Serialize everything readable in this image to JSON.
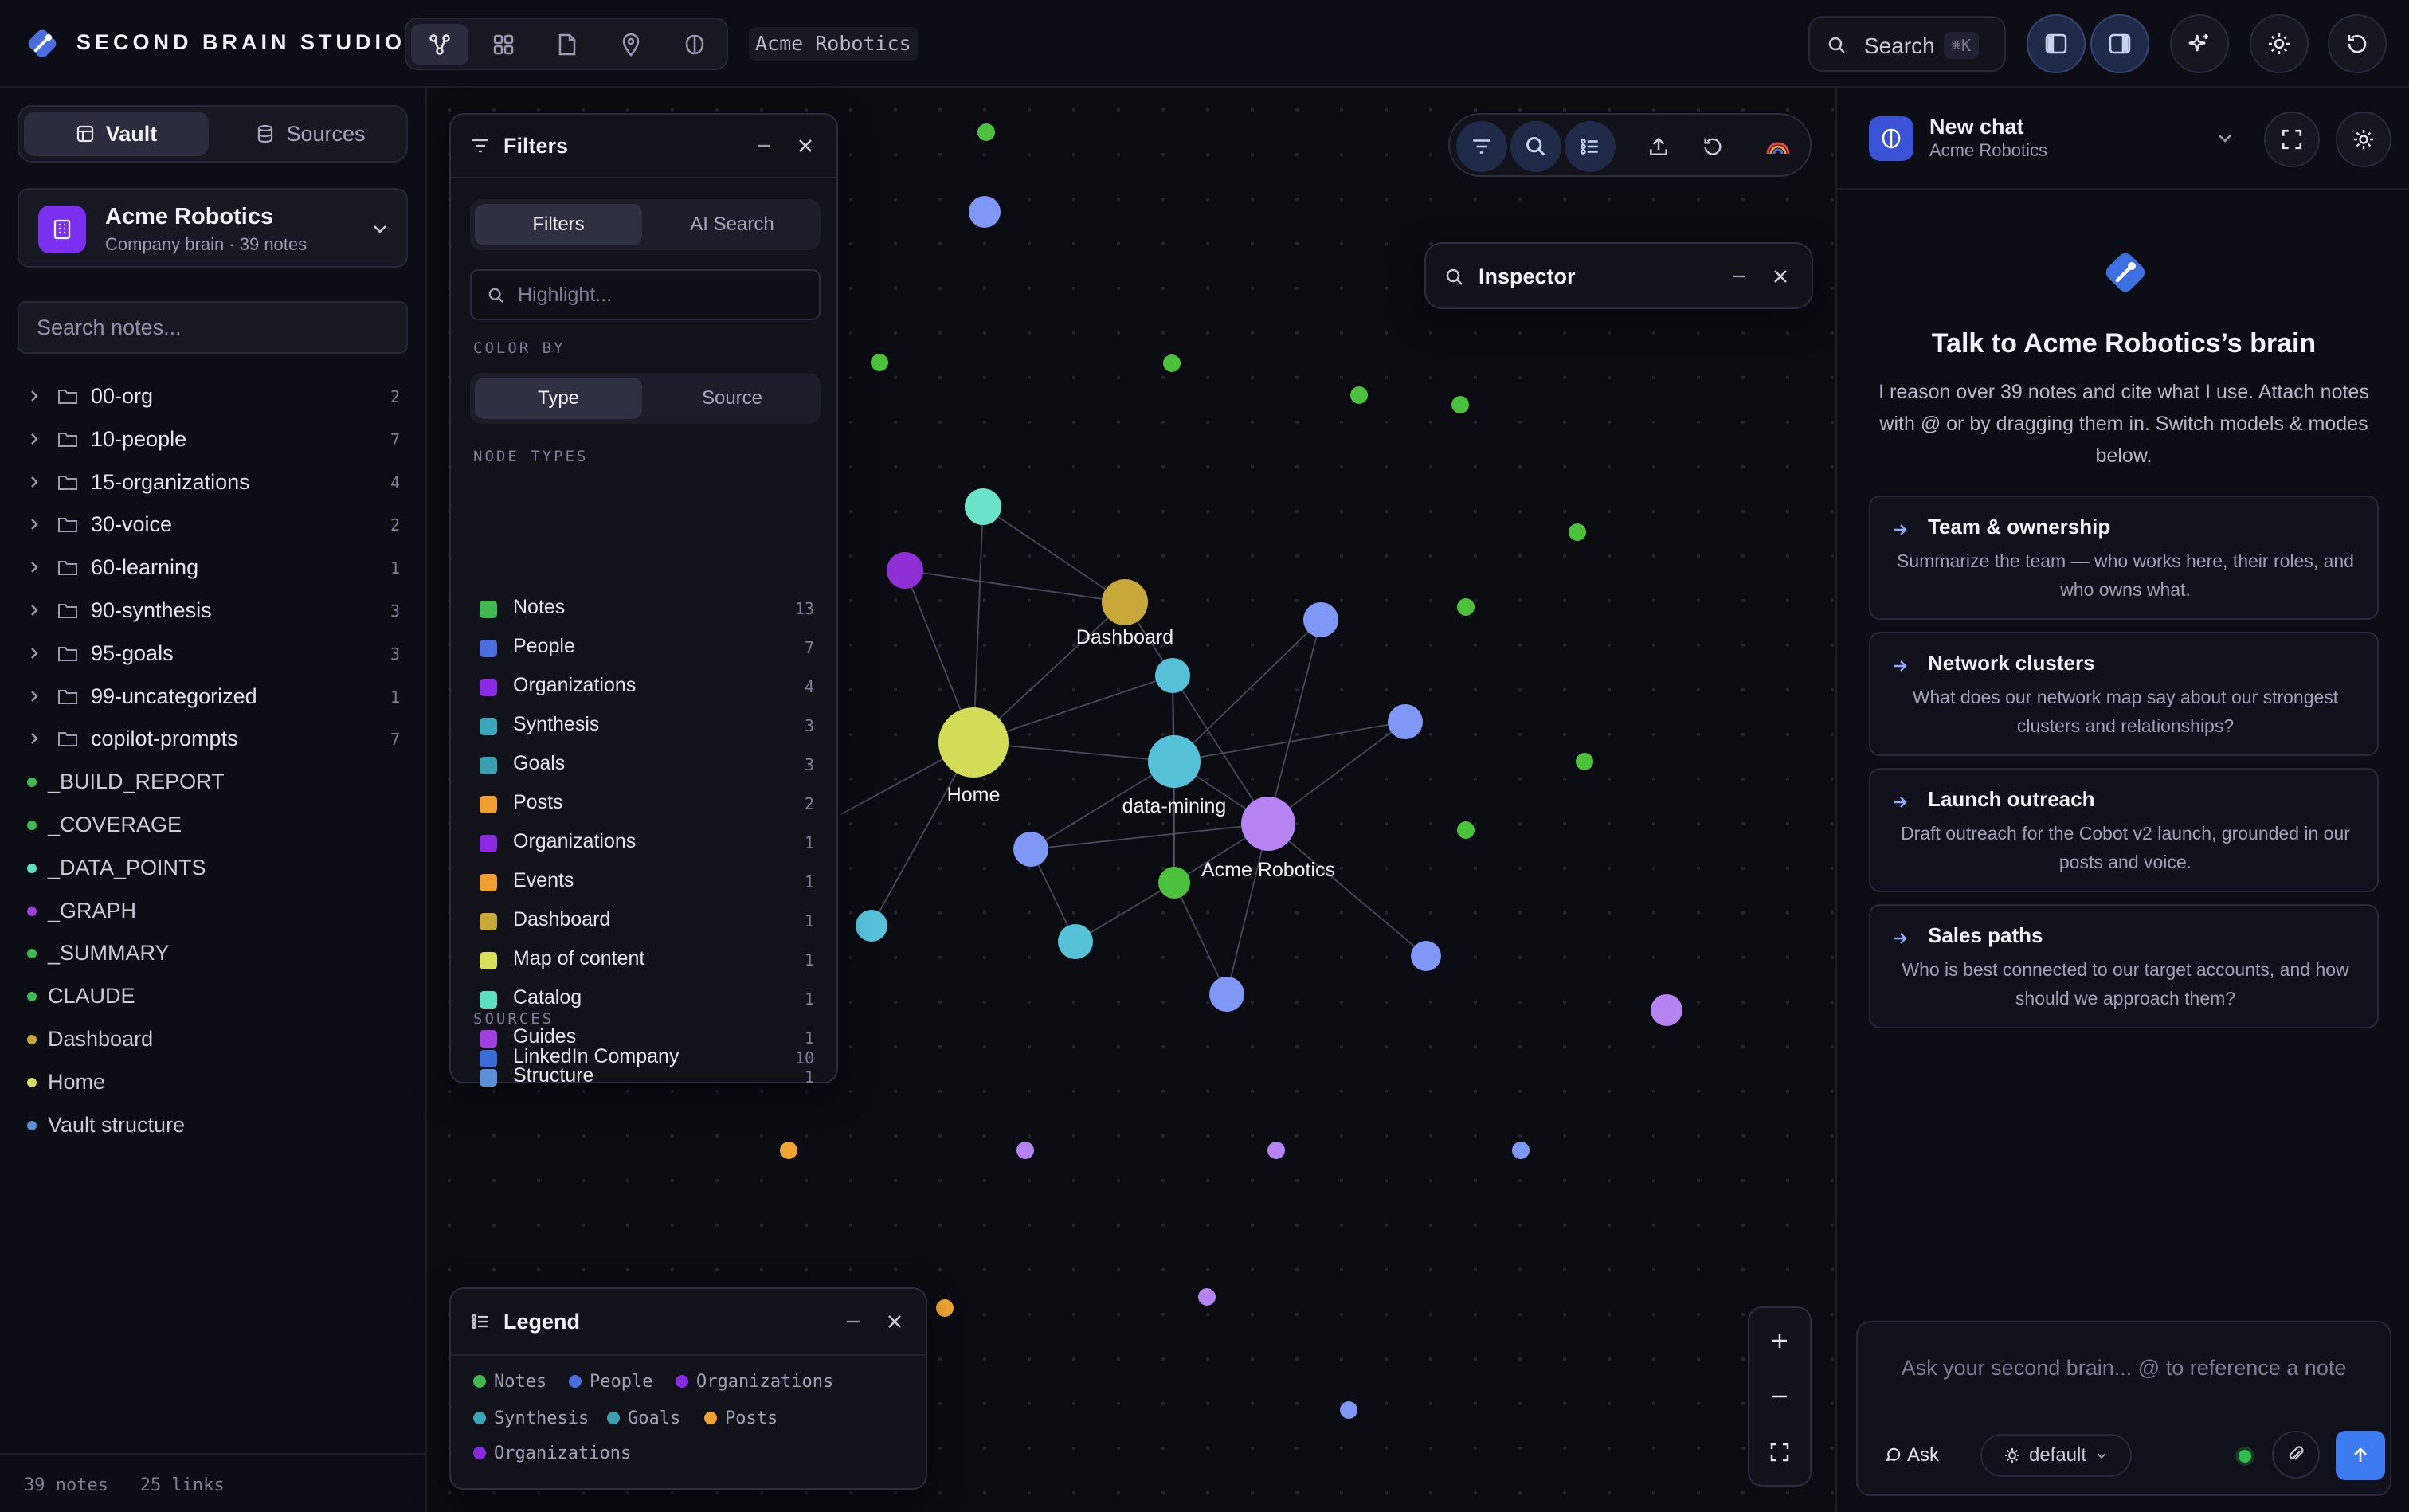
{
  "app": {
    "brand": "SECOND BRAIN STUDIO",
    "workspace_chip": "Acme Robotics",
    "search_label": "Search",
    "search_kbd": "⌘K",
    "mode_icons": [
      "graph-icon",
      "grid-icon",
      "page-icon",
      "pin-icon",
      "brain-icon"
    ],
    "top_icons": [
      "left-panel-icon",
      "right-panel-icon",
      "sparkle-icon",
      "sun-icon",
      "refresh-icon"
    ]
  },
  "sidebar": {
    "tabs": [
      "Vault",
      "Sources"
    ],
    "active_tab": "Vault",
    "vault": {
      "name": "Acme Robotics",
      "sub": "Company brain · 39 notes"
    },
    "search_placeholder": "Search notes...",
    "folders": [
      {
        "label": "00-org",
        "count": "2"
      },
      {
        "label": "10-people",
        "count": "7"
      },
      {
        "label": "15-organizations",
        "count": "4"
      },
      {
        "label": "30-voice",
        "count": "2"
      },
      {
        "label": "60-learning",
        "count": "1"
      },
      {
        "label": "90-synthesis",
        "count": "3"
      },
      {
        "label": "95-goals",
        "count": "3"
      },
      {
        "label": "99-uncategorized",
        "count": "1"
      },
      {
        "label": "copilot-prompts",
        "count": "7"
      }
    ],
    "files": [
      {
        "label": "_BUILD_REPORT",
        "color": "#3fb950"
      },
      {
        "label": "_COVERAGE",
        "color": "#3fb950"
      },
      {
        "label": "_DATA_POINTS",
        "color": "#5ee0c0"
      },
      {
        "label": "_GRAPH",
        "color": "#a03ee0"
      },
      {
        "label": "_SUMMARY",
        "color": "#3fb950"
      },
      {
        "label": "CLAUDE",
        "color": "#3fb950"
      },
      {
        "label": "Dashboard",
        "color": "#c9a83a"
      },
      {
        "label": "Home",
        "color": "#d9e05a"
      },
      {
        "label": "Vault structure",
        "color": "#5c8fd6"
      }
    ],
    "footer": "39 notes   25 links"
  },
  "filters": {
    "title": "Filters",
    "tabs": [
      "Filters",
      "AI Search"
    ],
    "highlight_placeholder": "Highlight...",
    "color_by_label": "COLOR BY",
    "color_by": [
      "Type",
      "Source"
    ],
    "node_types_label": "NODE TYPES",
    "node_types": [
      {
        "label": "Notes",
        "count": "13",
        "color": "#3fb950"
      },
      {
        "label": "People",
        "count": "7",
        "color": "#4a6ee0"
      },
      {
        "label": "Organizations",
        "count": "4",
        "color": "#8a2be2"
      },
      {
        "label": "Synthesis",
        "count": "3",
        "color": "#3aa6b9"
      },
      {
        "label": "Goals",
        "count": "3",
        "color": "#3a9fb0"
      },
      {
        "label": "Posts",
        "count": "2",
        "color": "#f0a030"
      },
      {
        "label": "Organizations",
        "count": "1",
        "color": "#8a2be2"
      },
      {
        "label": "Events",
        "count": "1",
        "color": "#f0a030"
      },
      {
        "label": "Dashboard",
        "count": "1",
        "color": "#c9a83a"
      },
      {
        "label": "Map of content",
        "count": "1",
        "color": "#d9e05a"
      },
      {
        "label": "Catalog",
        "count": "1",
        "color": "#5ee0c0"
      },
      {
        "label": "Guides",
        "count": "1",
        "color": "#a03ee0"
      },
      {
        "label": "Structure",
        "count": "1",
        "color": "#5c8fd6"
      }
    ],
    "sources_label": "SOURCES",
    "sources": [
      {
        "label": "LinkedIn Company",
        "count": "10",
        "color": "#3a6bd6"
      }
    ]
  },
  "inspector": {
    "title": "Inspector"
  },
  "legend": {
    "title": "Legend",
    "items": [
      {
        "label": "Notes",
        "color": "#3fb950"
      },
      {
        "label": "People",
        "color": "#4a6ee0"
      },
      {
        "label": "Organizations",
        "color": "#8a2be2"
      },
      {
        "label": "Synthesis",
        "color": "#3aa6b9"
      },
      {
        "label": "Goals",
        "color": "#3a9fb0"
      },
      {
        "label": "Posts",
        "color": "#f0a030"
      },
      {
        "label": "Organizations",
        "color": "#8a2be2"
      }
    ]
  },
  "graph": {
    "labels": {
      "dashboard": "Dashboard",
      "home": "Home",
      "data_mining": "data-mining",
      "acme": "Acme Robotics"
    }
  },
  "chat": {
    "title": "New chat",
    "subtitle": "Acme Robotics",
    "headline": "Talk to Acme Robotics’s brain",
    "intro": "I reason over 39 notes and cite what I use. Attach notes with @ or by dragging them in. Switch models & modes below.",
    "suggestions": [
      {
        "title": "Team & ownership",
        "desc": "Summarize the team — who works here, their roles, and who owns what."
      },
      {
        "title": "Network clusters",
        "desc": "What does our network map say about our strongest clusters and relationships?"
      },
      {
        "title": "Launch outreach",
        "desc": "Draft outreach for the Cobot v2 launch, grounded in our posts and voice."
      },
      {
        "title": "Sales paths",
        "desc": "Who is best connected to our target accounts, and how should we approach them?"
      }
    ],
    "composer_placeholder": "Ask your second brain...  @ to reference a note",
    "ask_label": "Ask",
    "model_label": "default"
  }
}
